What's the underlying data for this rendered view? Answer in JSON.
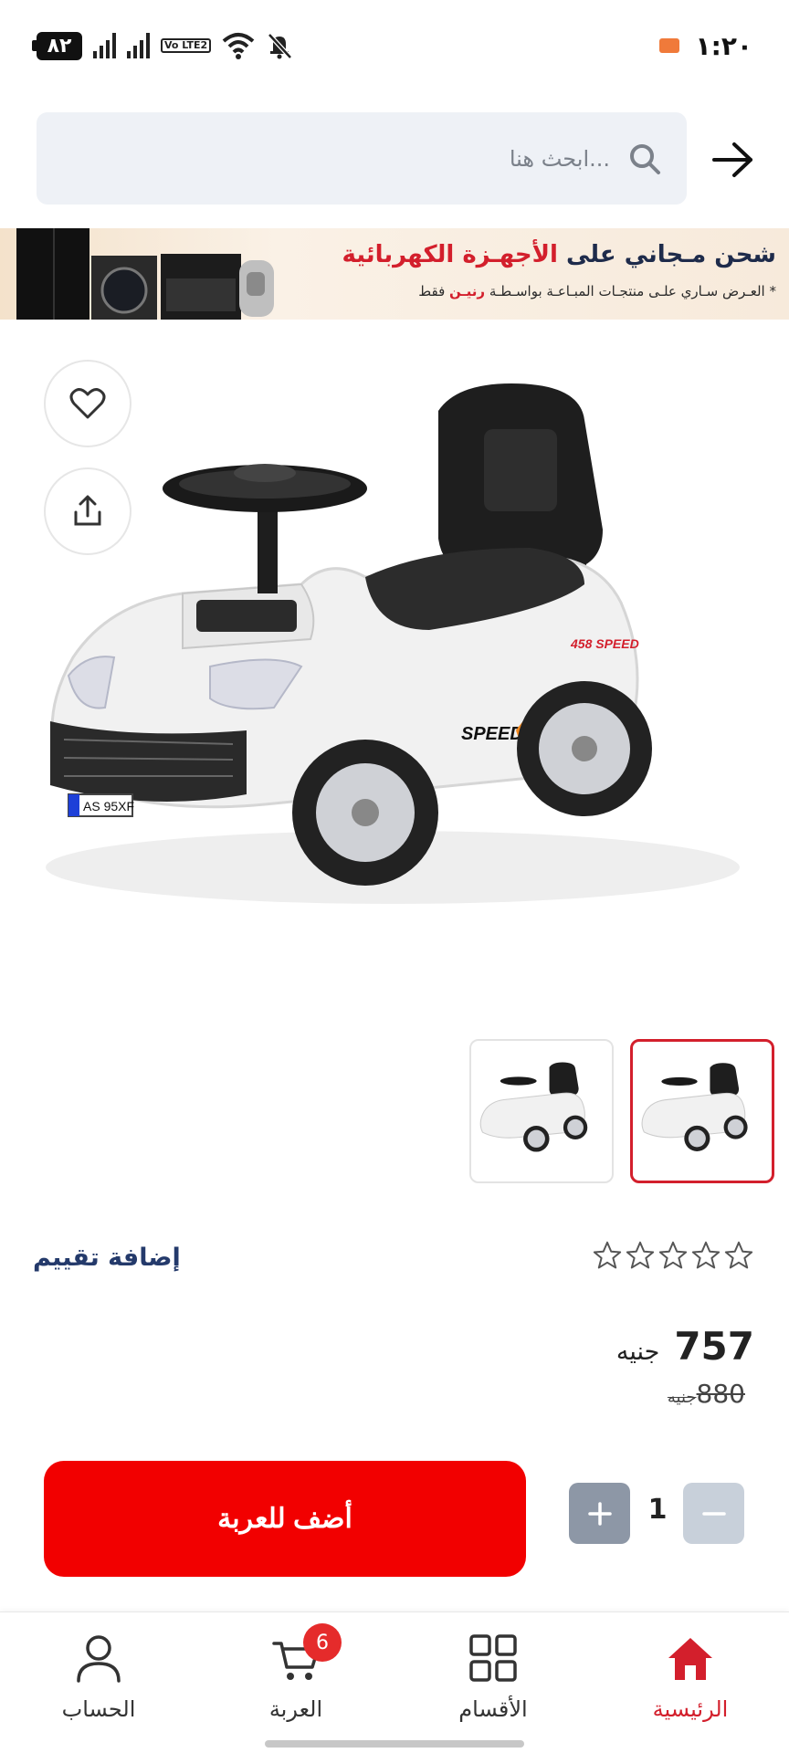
{
  "status_bar": {
    "time": "١:٢٠",
    "battery": "٨٢",
    "volte_label": "Vo LTE2"
  },
  "search": {
    "placeholder": "ابحث هنا..."
  },
  "banner": {
    "title_prefix": "شحن مـجاني على ",
    "title_highlight": "الأجهـزة الكهربائية",
    "subtitle_prefix": "* العـرض سـاري علـى منتجـات المبـاعـة بواسـطـة ",
    "subtitle_highlight": "رنيـن",
    "subtitle_suffix": " فقط"
  },
  "product": {
    "image_plate": "AS 95XF",
    "image_badge": "SPEED",
    "image_badge_2": "458 SPEED",
    "thumbnails_count": 2,
    "rating_stars": 0,
    "rating_max": 5,
    "add_review_label": "إضافة تقييم",
    "price": "757",
    "price_currency": "جنيه",
    "old_price": "880",
    "old_price_currency": "جنيه"
  },
  "cart": {
    "add_button_label": "أضف للعربة",
    "quantity": "1"
  },
  "bottom_nav": {
    "items": [
      {
        "label": "الرئيسية",
        "icon": "home-icon",
        "active": true
      },
      {
        "label": "الأقسام",
        "icon": "grid-icon",
        "active": false
      },
      {
        "label": "العربة",
        "icon": "cart-icon",
        "active": false,
        "badge": "6"
      },
      {
        "label": "الحساب",
        "icon": "user-icon",
        "active": false
      }
    ]
  },
  "colors": {
    "accent": "#d31f2c",
    "button_red": "#f20000",
    "search_bg": "#eef1f6",
    "qty_plus": "#8d97a6",
    "qty_minus": "#c8d0da"
  }
}
